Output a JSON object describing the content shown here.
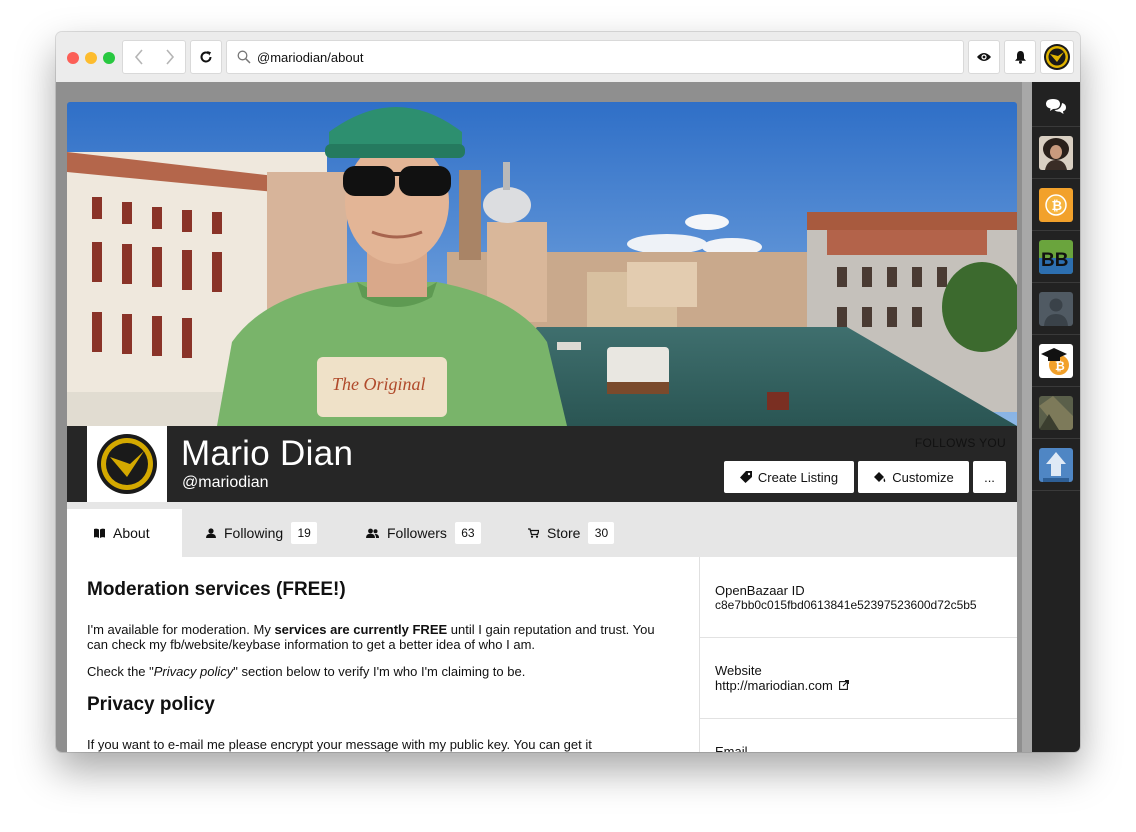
{
  "browser": {
    "address": "@mariodian/about"
  },
  "profile": {
    "name": "Mario Dian",
    "handle": "@mariodian",
    "follows_you": "FOLLOWS YOU",
    "buttons": {
      "create_listing": "Create Listing",
      "customize": "Customize",
      "more": "..."
    },
    "cover_text": "The Original"
  },
  "tabs": [
    {
      "label": "About"
    },
    {
      "label": "Following",
      "count": "19"
    },
    {
      "label": "Followers",
      "count": "63"
    },
    {
      "label": "Store",
      "count": "30"
    }
  ],
  "about": {
    "heading1": "Moderation services (FREE!)",
    "p1_a": "I'm available for moderation. My ",
    "p1_b": "services are currently FREE",
    "p1_c": " until I gain reputation and trust. You can check my fb/website/keybase information to get a better idea of who I am.",
    "p2_a": "Check the \"",
    "p2_b": "Privacy policy",
    "p2_c": "\" section below to verify I'm who I'm claiming to be.",
    "heading2": "Privacy policy",
    "p3": "If you want to e-mail me please encrypt your message with my public key. You can get it"
  },
  "info": {
    "id_label": "OpenBazaar ID",
    "id_value": "c8e7bb0c015fbd0613841e52397523600d72c5b5",
    "website_label": "Website",
    "website_value": "http://mariodian.com",
    "email_label": "Email"
  },
  "sidebar": {
    "bb_text": "BB"
  },
  "colors": {
    "header_bg": "#262626",
    "sidebar_bg": "#222222",
    "tab_bar_bg": "#e6e6e6"
  }
}
